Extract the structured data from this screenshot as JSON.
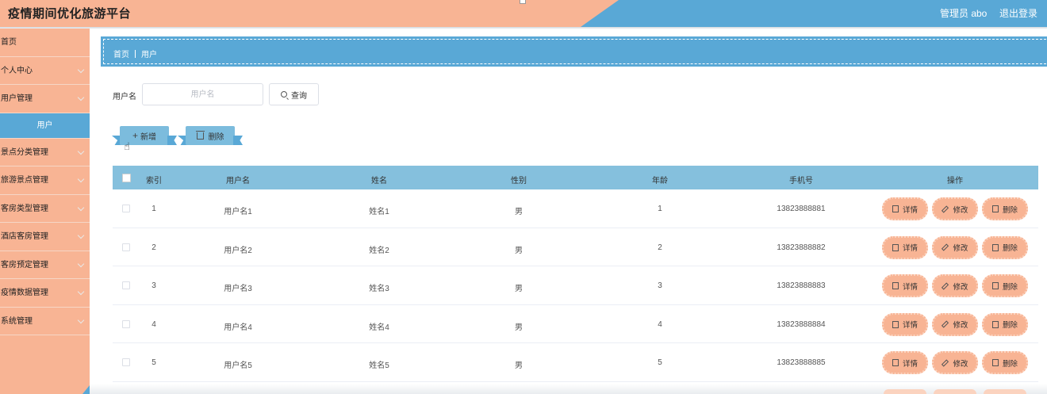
{
  "header": {
    "title": "疫情期间优化旅游平台",
    "user": "管理员 abo",
    "logout": "退出登录"
  },
  "sidebar": {
    "items": [
      {
        "label": "首页",
        "chevron": false
      },
      {
        "label": "个人中心",
        "chevron": true
      },
      {
        "label": "用户管理",
        "chevron": true
      },
      {
        "label": "用户",
        "active": true
      },
      {
        "label": "景点分类管理",
        "chevron": true
      },
      {
        "label": "旅游景点管理",
        "chevron": true
      },
      {
        "label": "客房类型管理",
        "chevron": true
      },
      {
        "label": "酒店客房管理",
        "chevron": true
      },
      {
        "label": "客房预定管理",
        "chevron": true
      },
      {
        "label": "疫情数据管理",
        "chevron": true
      },
      {
        "label": "系统管理",
        "chevron": true
      }
    ]
  },
  "breadcrumb": {
    "home": "首页",
    "current": "用户"
  },
  "search": {
    "label": "用户名",
    "placeholder": "用户名",
    "value": "",
    "button": "查询"
  },
  "actions": {
    "add": "新增",
    "delete": "删除"
  },
  "table": {
    "headers": [
      "索引",
      "用户名",
      "姓名",
      "性别",
      "年龄",
      "手机号",
      "操作"
    ],
    "rows": [
      {
        "index": "1",
        "username": "用户名1",
        "name": "姓名1",
        "gender": "男",
        "age": "1",
        "phone": "13823888881"
      },
      {
        "index": "2",
        "username": "用户名2",
        "name": "姓名2",
        "gender": "男",
        "age": "2",
        "phone": "13823888882"
      },
      {
        "index": "3",
        "username": "用户名3",
        "name": "姓名3",
        "gender": "男",
        "age": "3",
        "phone": "13823888883"
      },
      {
        "index": "4",
        "username": "用户名4",
        "name": "姓名4",
        "gender": "男",
        "age": "4",
        "phone": "13823888884"
      },
      {
        "index": "5",
        "username": "用户名5",
        "name": "姓名5",
        "gender": "男",
        "age": "5",
        "phone": "13823888885"
      }
    ],
    "row_actions": {
      "detail": "详情",
      "edit": "修改",
      "delete": "删除"
    }
  },
  "colors": {
    "peach": "#f8b494",
    "blue": "#59a8d6",
    "table_header": "#85c0dd"
  }
}
